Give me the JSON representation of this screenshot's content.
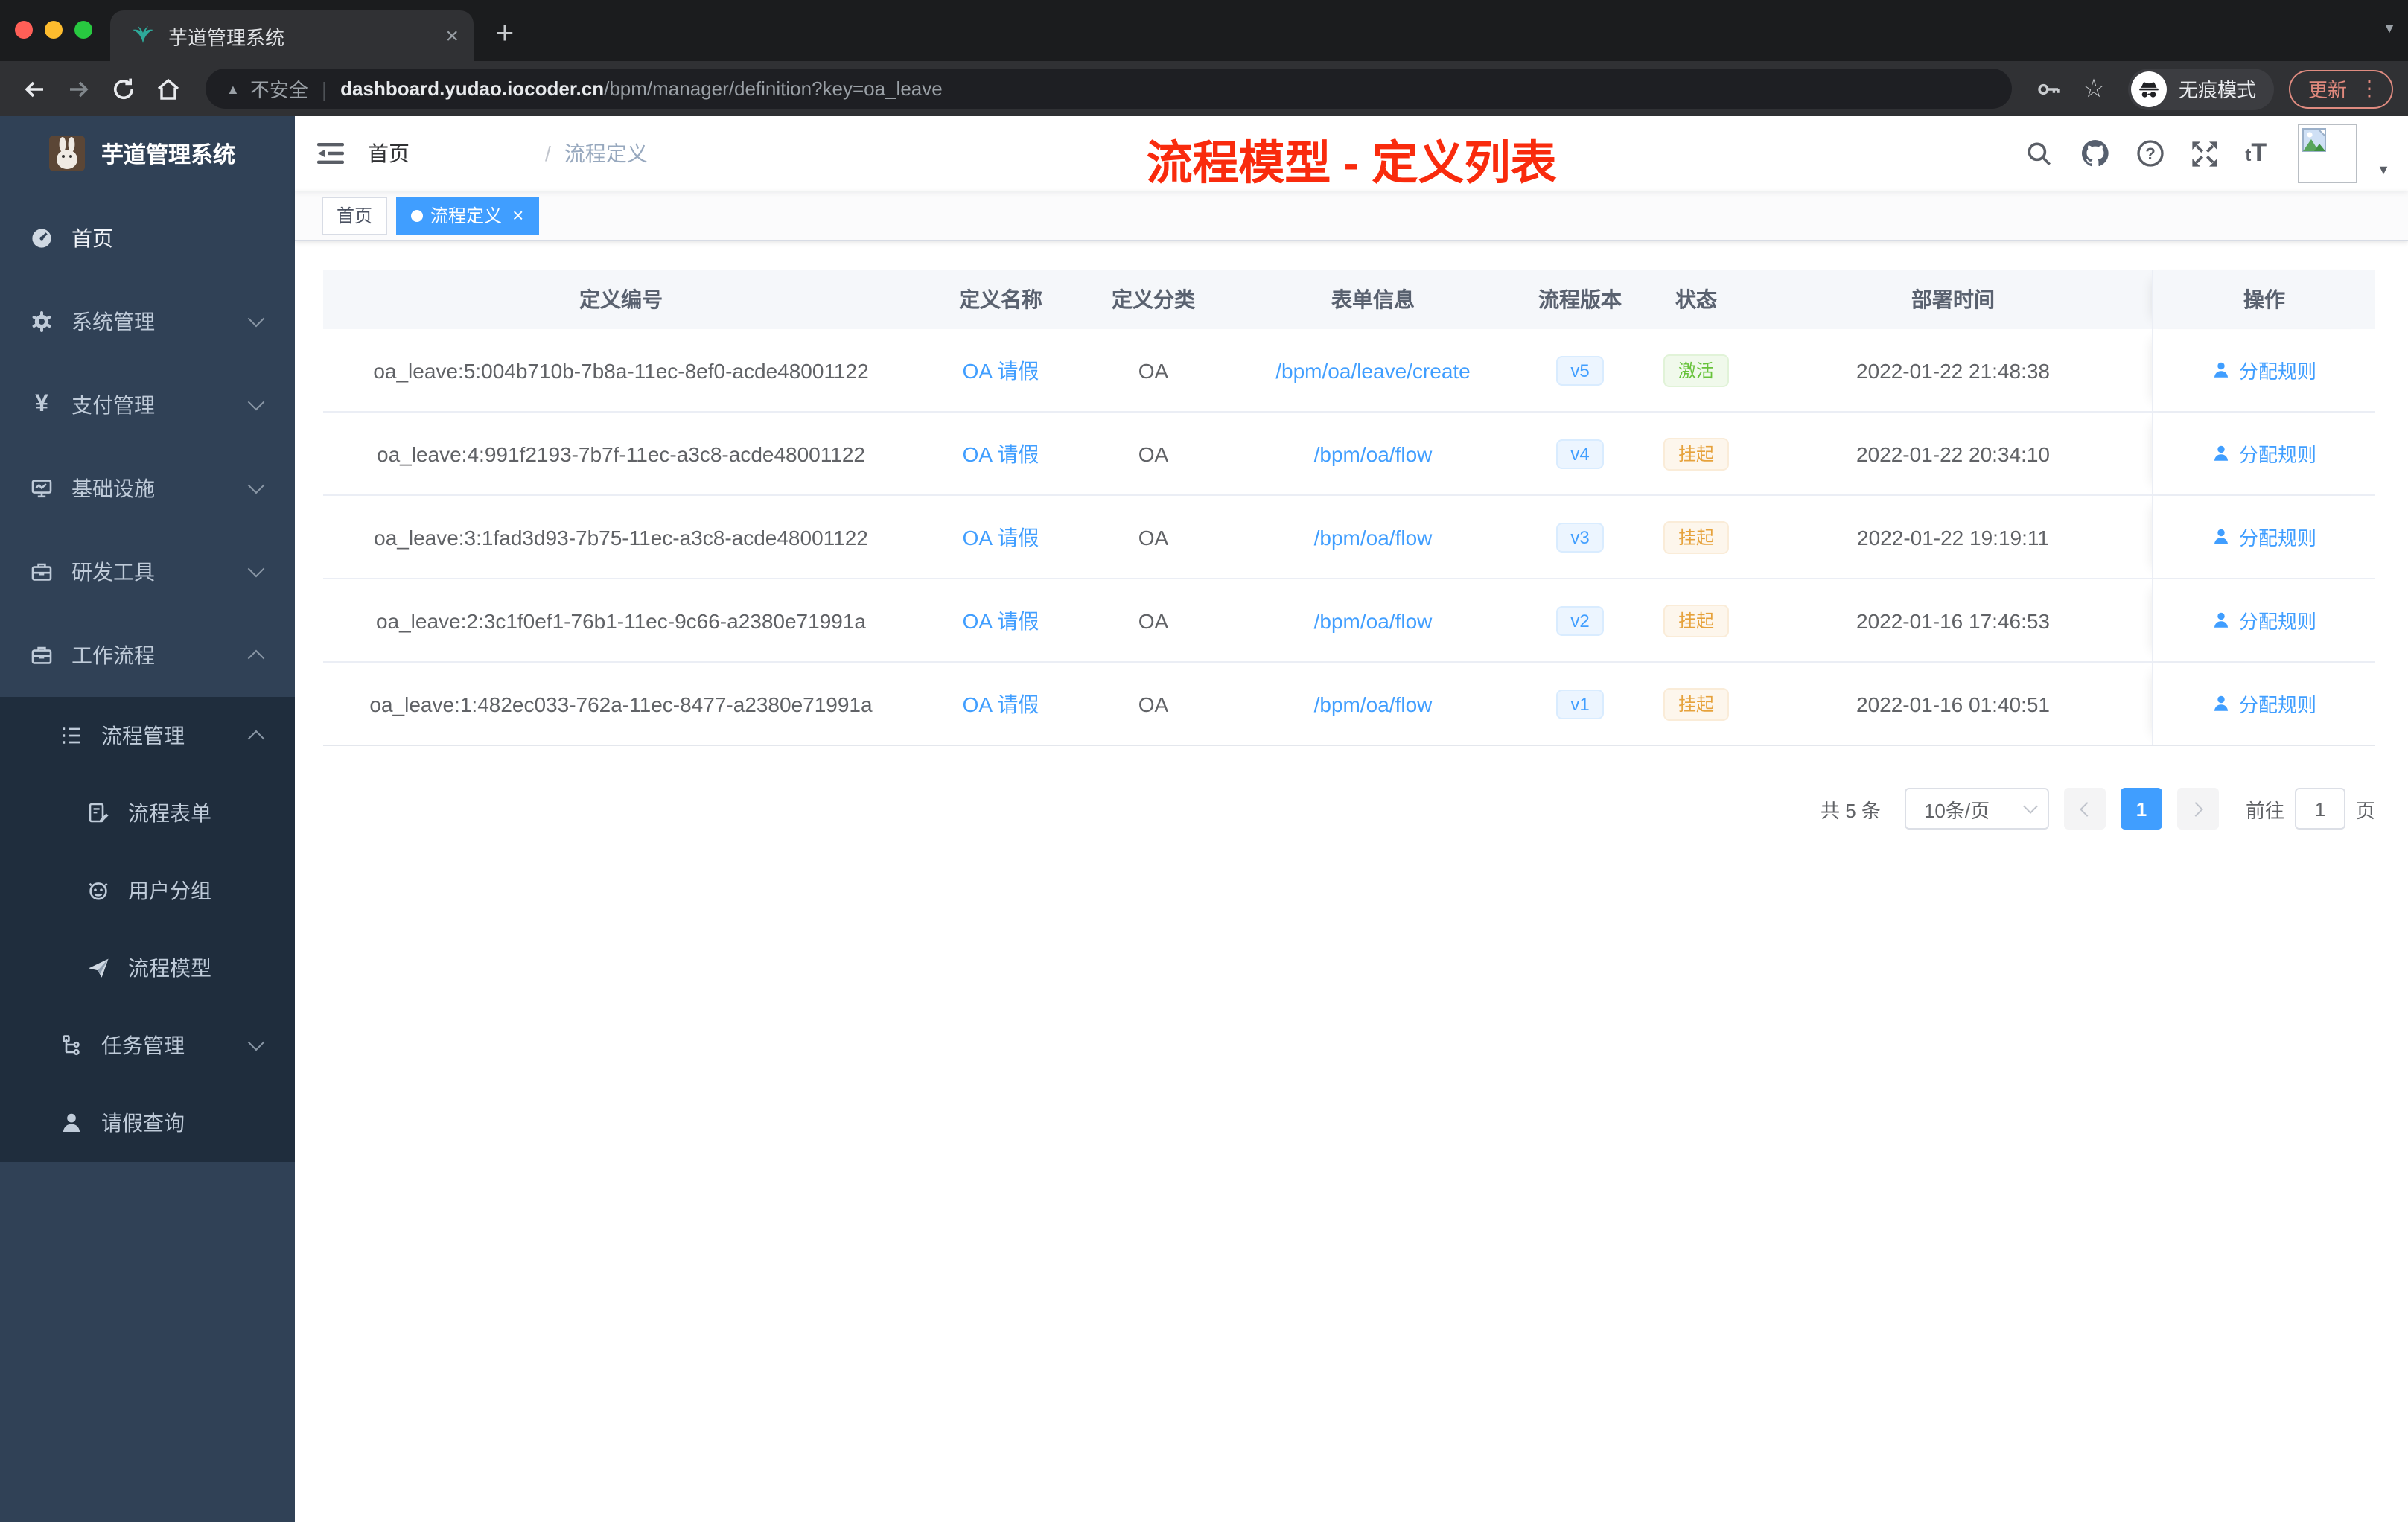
{
  "browser": {
    "tab_title": "芋道管理系统",
    "security_label": "不安全",
    "url_host": "dashboard.yudao.iocoder.cn",
    "url_path": "/bpm/manager/definition?key=oa_leave",
    "incognito_label": "无痕模式",
    "update_label": "更新"
  },
  "icons": {
    "close": "×",
    "plus": "+",
    "caret_down": "▼",
    "star": "☆",
    "more_vert": "⋮",
    "warning": "▲",
    "divider": "|",
    "font_size": "tT"
  },
  "sidebar": {
    "app_title": "芋道管理系统",
    "items": [
      {
        "label": "首页",
        "icon": "dashboard-icon"
      },
      {
        "label": "系统管理",
        "icon": "gear-icon",
        "arrow": "down"
      },
      {
        "label": "支付管理",
        "icon": "yen-icon",
        "arrow": "down",
        "icon_glyph": "¥"
      },
      {
        "label": "基础设施",
        "icon": "monitor-icon",
        "arrow": "down"
      },
      {
        "label": "研发工具",
        "icon": "toolbox-icon",
        "arrow": "down"
      },
      {
        "label": "工作流程",
        "icon": "toolbox-icon",
        "arrow": "up"
      }
    ],
    "submenu": [
      {
        "label": "流程管理",
        "icon": "list-icon",
        "arrow": "up"
      },
      {
        "label": "流程表单",
        "icon": "form-icon"
      },
      {
        "label": "用户分组",
        "icon": "user-group-icon"
      },
      {
        "label": "流程模型",
        "icon": "paper-plane-icon"
      },
      {
        "label": "任务管理",
        "icon": "tree-icon",
        "arrow": "down"
      },
      {
        "label": "请假查询",
        "icon": "person-icon"
      }
    ]
  },
  "header": {
    "breadcrumb_home": "首页",
    "breadcrumb_sep": "/",
    "breadcrumb_current": "流程定义",
    "annotation": "流程模型 - 定义列表"
  },
  "tags": [
    {
      "label": "首页",
      "active": false
    },
    {
      "label": "流程定义",
      "active": true
    }
  ],
  "table": {
    "columns": [
      "定义编号",
      "定义名称",
      "定义分类",
      "表单信息",
      "流程版本",
      "状态",
      "部署时间",
      "操作"
    ],
    "rows": [
      {
        "id": "oa_leave:5:004b710b-7b8a-11ec-8ef0-acde48001122",
        "name": "OA 请假",
        "category": "OA",
        "form": "/bpm/oa/leave/create",
        "version": "v5",
        "status": "激活",
        "status_type": "active",
        "deploy_time": "2022-01-22 21:48:38",
        "action": "分配规则"
      },
      {
        "id": "oa_leave:4:991f2193-7b7f-11ec-a3c8-acde48001122",
        "name": "OA 请假",
        "category": "OA",
        "form": "/bpm/oa/flow",
        "version": "v4",
        "status": "挂起",
        "status_type": "suspended",
        "deploy_time": "2022-01-22 20:34:10",
        "action": "分配规则"
      },
      {
        "id": "oa_leave:3:1fad3d93-7b75-11ec-a3c8-acde48001122",
        "name": "OA 请假",
        "category": "OA",
        "form": "/bpm/oa/flow",
        "version": "v3",
        "status": "挂起",
        "status_type": "suspended",
        "deploy_time": "2022-01-22 19:19:11",
        "action": "分配规则"
      },
      {
        "id": "oa_leave:2:3c1f0ef1-76b1-11ec-9c66-a2380e71991a",
        "name": "OA 请假",
        "category": "OA",
        "form": "/bpm/oa/flow",
        "version": "v2",
        "status": "挂起",
        "status_type": "suspended",
        "deploy_time": "2022-01-16 17:46:53",
        "action": "分配规则"
      },
      {
        "id": "oa_leave:1:482ec033-762a-11ec-8477-a2380e71991a",
        "name": "OA 请假",
        "category": "OA",
        "form": "/bpm/oa/flow",
        "version": "v1",
        "status": "挂起",
        "status_type": "suspended",
        "deploy_time": "2022-01-16 01:40:51",
        "action": "分配规则"
      }
    ]
  },
  "pagination": {
    "total": "共 5 条",
    "page_size": "10条/页",
    "current_page": "1",
    "goto_label": "前往",
    "goto_value": "1",
    "page_unit": "页"
  },
  "colors": {
    "accent_blue": "#409eff",
    "annotation_red": "#f92b0d",
    "status_active_green": "#67c23a",
    "status_suspended_orange": "#e6a23c",
    "version_tag_blue": "#409eff",
    "sidebar_bg": "#304156",
    "sidebar_submenu_bg": "#1f2d3d",
    "tag_active_bg": "#409eff",
    "update_button_red": "#e0897d"
  }
}
